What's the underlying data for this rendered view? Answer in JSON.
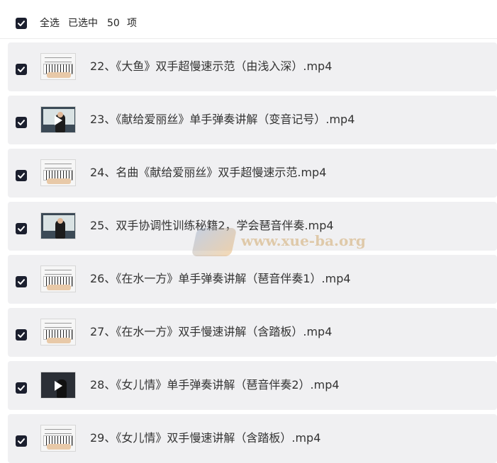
{
  "header": {
    "select_all_label": "全选",
    "selected_label": "已选中",
    "selected_count": "50",
    "unit_label": "项"
  },
  "files": [
    {
      "title": "22、《大鱼》双手超慢速示范（由浅入深）.mp4",
      "thumb": "piano"
    },
    {
      "title": "23、《献给爱丽丝》单手弹奏讲解（变音记号）.mp4",
      "thumb": "teacher"
    },
    {
      "title": "24、名曲《献给爱丽丝》双手超慢速示范.mp4",
      "thumb": "piano"
    },
    {
      "title": "25、双手协调性训练秘籍2，学会琶音伴奏.mp4",
      "thumb": "teacher"
    },
    {
      "title": "26、《在水一方》单手弹奏讲解（琶音伴奏1）.mp4",
      "thumb": "piano"
    },
    {
      "title": "27、《在水一方》双手慢速讲解（含踏板）.mp4",
      "thumb": "piano"
    },
    {
      "title": "28、《女儿情》单手弹奏讲解（琶音伴奏2）.mp4",
      "thumb": "dark"
    },
    {
      "title": "29、《女儿情》双手慢速讲解（含踏板）.mp4",
      "thumb": "piano"
    }
  ],
  "watermark": "www.xue-ba.org",
  "colors": {
    "checkbox": "#1b1f2e",
    "row_background": "#f0f0f2"
  }
}
